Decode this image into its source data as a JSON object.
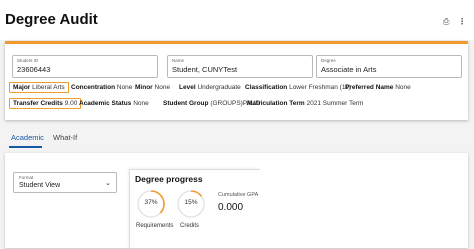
{
  "header": {
    "title": "Degree Audit",
    "print_icon": "⎙",
    "more_icon": "⋮"
  },
  "summary": {
    "student_id": {
      "label": "Student ID",
      "value": "23606443"
    },
    "name": {
      "label": "Name",
      "value": "Student, CUNYTest"
    },
    "degree": {
      "label": "Degree",
      "value": "Associate in Arts"
    },
    "row1": {
      "major_label": "Major",
      "major_value": "Liberal Arts",
      "concentration_label": "Concentration",
      "concentration_value": "None",
      "minor_label": "Minor",
      "minor_value": "None",
      "level_label": "Level",
      "level_value": "Undergraduate",
      "classification_label": "Classification",
      "classification_value": "Lower Freshman (11)",
      "preferred_label": "Preferred Name",
      "preferred_value": "None"
    },
    "row2": {
      "transfer_label": "Transfer Credits",
      "transfer_value": "9.00",
      "academic_status_label": "Academic Status",
      "academic_status_value": "None",
      "student_group_label": "Student Group",
      "student_group_value": "(GROUPS)PAUD",
      "matriculation_label": "Matriculation Term",
      "matriculation_value": "2021 Summer Term"
    },
    "accent_color": "#f29a2e"
  },
  "tabs": [
    {
      "label": "Academic",
      "active": true
    },
    {
      "label": "What-If",
      "active": false
    }
  ],
  "format": {
    "label": "Format",
    "value": "Student View",
    "chevron": "⌄"
  },
  "progress": {
    "title": "Degree progress",
    "requirements": {
      "percent_text": "37%",
      "label": "Requirements",
      "fraction": 0.37
    },
    "credits": {
      "percent_text": "15%",
      "label": "Credits",
      "fraction": 0.15
    },
    "gpa_label": "Cumulative GPA",
    "gpa_value": "0.000",
    "ring_color": "#f29a2e",
    "track_color": "#e6e6e6"
  }
}
